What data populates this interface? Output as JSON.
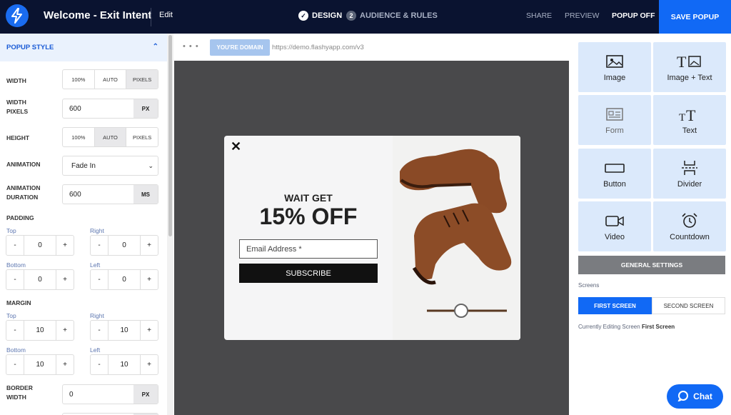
{
  "topbar": {
    "title": "Welcome - Exit Intent",
    "edit": "Edit",
    "step1": "DESIGN",
    "step2_num": "2",
    "step2": "AUDIENCE & RULES",
    "share": "SHARE",
    "preview": "PREVIEW",
    "popup_off": "POPUP OFF",
    "save": "SAVE POPUP"
  },
  "left": {
    "section": "POPUP STYLE",
    "width_label": "WIDTH",
    "width_opts": [
      "100%",
      "AUTO",
      "PIXELS"
    ],
    "width_pixels_label1": "WIDTH",
    "width_pixels_label2": "PIXELS",
    "width_pixels_value": "600",
    "width_pixels_unit": "PX",
    "height_label": "HEIGHT",
    "height_opts": [
      "100%",
      "AUTO",
      "PIXELS"
    ],
    "animation_label": "ANIMATION",
    "animation_value": "Fade In",
    "anim_dur_label1": "ANIMATION",
    "anim_dur_label2": "DURATION",
    "anim_dur_value": "600",
    "anim_dur_unit": "MS",
    "padding_label": "PADDING",
    "margin_label": "MARGIN",
    "top": "Top",
    "right": "Right",
    "bottom": "Bottom",
    "left_lbl": "Left",
    "minus": "-",
    "plus": "+",
    "padding": {
      "top": "0",
      "right": "0",
      "bottom": "0",
      "left": "0"
    },
    "margin": {
      "top": "10",
      "right": "10",
      "bottom": "10",
      "left": "10"
    },
    "border_label1": "BORDER",
    "border_label2": "WIDTH",
    "border_value": "0",
    "border_unit": "PX"
  },
  "browser": {
    "dots": "• • •",
    "domain": "YOU'RE DOMAIN",
    "url": "https://demo.flashyapp.com/v3"
  },
  "popup": {
    "close": "✕",
    "headline": "WAIT GET",
    "offer": "15% OFF",
    "email_placeholder": "Email Address *",
    "subscribe": "SUBSCRIBE"
  },
  "elements": {
    "image": "Image",
    "image_text": "Image + Text",
    "form": "Form",
    "text": "Text",
    "button": "Button",
    "divider": "Divider",
    "video": "Video",
    "countdown": "Countdown"
  },
  "settings": {
    "general": "GENERAL SETTINGS",
    "screens": "Screens",
    "first": "FIRST SCREEN",
    "second": "SECOND SCREEN",
    "current_prefix": "Currently Editing Screen",
    "current_value": "First Screen"
  },
  "chat": "Chat",
  "colors": {
    "brand": "#1169f5",
    "topbar": "#0a1330",
    "tile": "#dbe9fb",
    "canvas": "#49494b"
  }
}
